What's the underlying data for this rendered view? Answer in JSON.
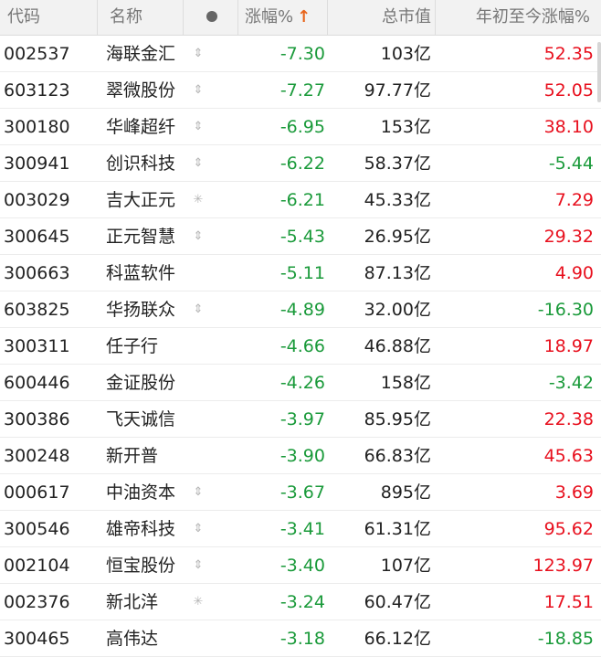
{
  "header": {
    "code": "代码",
    "name": "名称",
    "change": "涨幅%",
    "sort_arrow": "↑",
    "cap": "总市值",
    "ytd": "年初至今涨幅%"
  },
  "rows": [
    {
      "code": "002537",
      "name": "海联金汇",
      "flag": "⇕",
      "change": "-7.30",
      "cap": "103亿",
      "ytd": "52.35"
    },
    {
      "code": "603123",
      "name": "翠微股份",
      "flag": "⇕",
      "change": "-7.27",
      "cap": "97.77亿",
      "ytd": "52.05"
    },
    {
      "code": "300180",
      "name": "华峰超纤",
      "flag": "⇕",
      "change": "-6.95",
      "cap": "153亿",
      "ytd": "38.10"
    },
    {
      "code": "300941",
      "name": "创识科技",
      "flag": "⇕",
      "change": "-6.22",
      "cap": "58.37亿",
      "ytd": "-5.44"
    },
    {
      "code": "003029",
      "name": "吉大正元",
      "flag": "✳",
      "change": "-6.21",
      "cap": "45.33亿",
      "ytd": "7.29"
    },
    {
      "code": "300645",
      "name": "正元智慧",
      "flag": "⇕",
      "change": "-5.43",
      "cap": "26.95亿",
      "ytd": "29.32"
    },
    {
      "code": "300663",
      "name": "科蓝软件",
      "flag": "",
      "change": "-5.11",
      "cap": "87.13亿",
      "ytd": "4.90"
    },
    {
      "code": "603825",
      "name": "华扬联众",
      "flag": "⇕",
      "change": "-4.89",
      "cap": "32.00亿",
      "ytd": "-16.30"
    },
    {
      "code": "300311",
      "name": "任子行",
      "flag": "",
      "change": "-4.66",
      "cap": "46.88亿",
      "ytd": "18.97"
    },
    {
      "code": "600446",
      "name": "金证股份",
      "flag": "",
      "change": "-4.26",
      "cap": "158亿",
      "ytd": "-3.42"
    },
    {
      "code": "300386",
      "name": "飞天诚信",
      "flag": "",
      "change": "-3.97",
      "cap": "85.95亿",
      "ytd": "22.38"
    },
    {
      "code": "300248",
      "name": "新开普",
      "flag": "",
      "change": "-3.90",
      "cap": "66.83亿",
      "ytd": "45.63"
    },
    {
      "code": "000617",
      "name": "中油资本",
      "flag": "⇕",
      "change": "-3.67",
      "cap": "895亿",
      "ytd": "3.69"
    },
    {
      "code": "300546",
      "name": "雄帝科技",
      "flag": "⇕",
      "change": "-3.41",
      "cap": "61.31亿",
      "ytd": "95.62"
    },
    {
      "code": "002104",
      "name": "恒宝股份",
      "flag": "⇕",
      "change": "-3.40",
      "cap": "107亿",
      "ytd": "123.97"
    },
    {
      "code": "002376",
      "name": "新北洋",
      "flag": "✳",
      "change": "-3.24",
      "cap": "60.47亿",
      "ytd": "17.51"
    },
    {
      "code": "300465",
      "name": "高伟达",
      "flag": "",
      "change": "-3.18",
      "cap": "66.12亿",
      "ytd": "-18.85"
    }
  ],
  "colors": {
    "up": "#e8101e",
    "down": "#1a9a3a",
    "header_bg": "#f2f2f2",
    "sort_arrow": "#e8641b"
  },
  "icons": {
    "flag_move": "updown-arrow-icon",
    "flag_star": "asterisk-icon",
    "column_dot": "dot-icon"
  }
}
